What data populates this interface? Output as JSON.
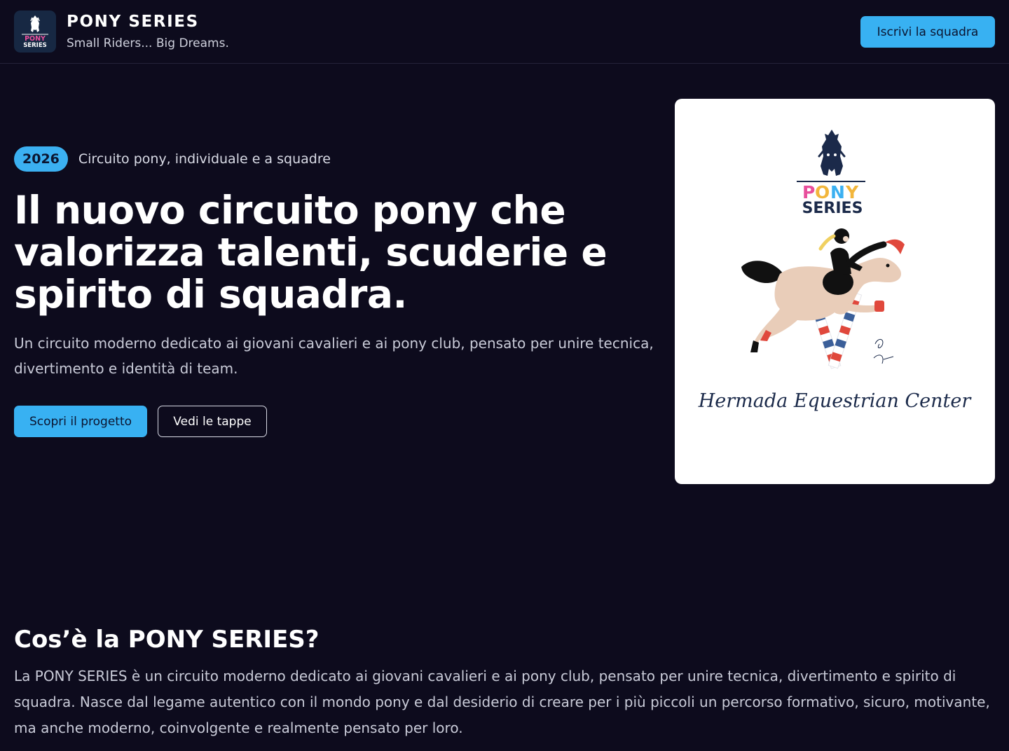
{
  "header": {
    "brand_title": "PONY SERIES",
    "tagline": "Small Riders... Big Dreams.",
    "logo_line1": "PONY",
    "logo_line2": "SERIES",
    "cta_label": "Iscrivi la squadra"
  },
  "hero": {
    "year_badge": "2026",
    "badge_text": "Circuito pony, individuale e a squadre",
    "title": "Il nuovo circuito pony che valorizza talenti, scuderie e spirito di squadra.",
    "subtitle": "Un circuito moderno dedicato ai giovani cavalieri e ai pony club, pensato per unire tecnica, divertimento e identità di team.",
    "primary_button": "Scopri il progetto",
    "secondary_button": "Vedi le tappe",
    "card": {
      "logo_pony": "PONY",
      "logo_series": "SERIES",
      "signature": "Hermada Equestrian Center",
      "pony_letter_colors": [
        "#e84f9c",
        "#f2b63c",
        "#3bb0f1",
        "#f2b63c"
      ]
    }
  },
  "about": {
    "title": "Cos’è la PONY SERIES?",
    "text": "La PONY SERIES è un circuito moderno dedicato ai giovani cavalieri e ai pony club, pensato per unire tecnica, divertimento e spirito di squadra. Nasce dal legame autentico con il mondo pony e dal desiderio di creare per i più piccoli un percorso formativo, sicuro, motivante, ma anche moderno, coinvolgente e realmente pensato per loro."
  },
  "colors": {
    "background": "#0d0b1d",
    "accent": "#38b1f2",
    "navy": "#1b2a4a"
  }
}
